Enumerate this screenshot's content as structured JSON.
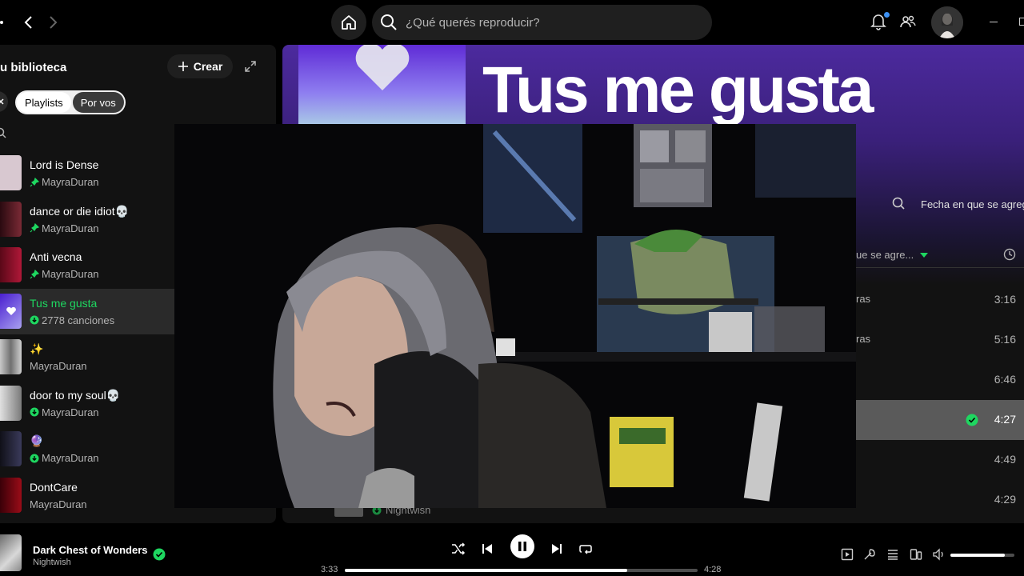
{
  "topbar": {
    "search_placeholder": "¿Qué querés reproducir?"
  },
  "sidebar": {
    "title": "u biblioteca",
    "create_label": "Crear",
    "chips": [
      "Playlists",
      "Por vos"
    ],
    "items": [
      {
        "name": "Lord is Dense",
        "sub": "MayraDuran",
        "pinned": true,
        "cover": "#d8c8d0"
      },
      {
        "name": "dance or die idiot💀",
        "sub": "MayraDuran",
        "pinned": true,
        "cover": "#5a1a22"
      },
      {
        "name": "Anti vecna",
        "sub": "MayraDuran",
        "pinned": true,
        "cover": "#8a1028"
      },
      {
        "name": "Tus me gusta",
        "sub": "2778 canciones",
        "downloaded": true,
        "active": true,
        "cover": "#6a3cf0"
      },
      {
        "name": "✨",
        "sub": "MayraDuran",
        "cover": "#9a9a9a"
      },
      {
        "name": "door to my soul💀",
        "sub": "MayraDuran",
        "downloaded": true,
        "cover": "#a8a8a8"
      },
      {
        "name": "🔮",
        "sub": "MayraDuran",
        "downloaded": true,
        "cover": "#2a2a40"
      },
      {
        "name": "DontCare",
        "sub": "MayraDuran",
        "cover": "#7a0a14"
      }
    ]
  },
  "main": {
    "title": "Tus me gusta",
    "sort_label": "Fecha en que se agreg",
    "column_header": "ue se agre...",
    "tracks": [
      {
        "frag": "ras",
        "duration": "3:16"
      },
      {
        "frag": "ras",
        "duration": "5:16"
      },
      {
        "frag": "",
        "duration": "6:46"
      },
      {
        "frag": "",
        "duration": "4:27",
        "selected": true,
        "downloaded": true
      },
      {
        "frag": "",
        "duration": "4:49"
      },
      {
        "frag": "",
        "duration": "4:29"
      }
    ],
    "under_artist": "Nightwish"
  },
  "player": {
    "title": "Dark Chest of Wonders",
    "artist": "Nightwish",
    "elapsed": "3:33",
    "total": "4:28",
    "progress": 0.8,
    "volume": 0.85
  },
  "colors": {
    "accent": "#1ed760",
    "hero": "#4c2a9e",
    "panel": "#121212"
  }
}
